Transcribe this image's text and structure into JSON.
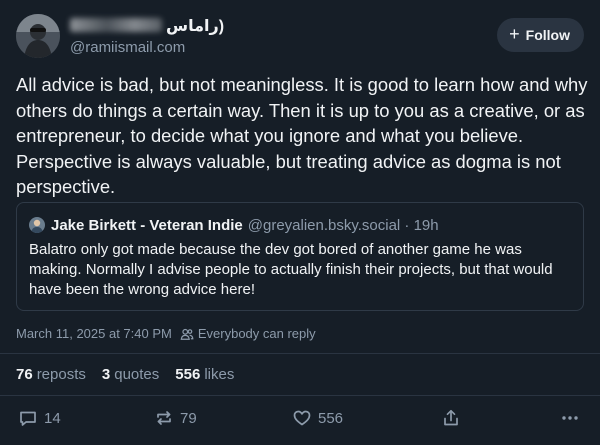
{
  "author": {
    "display_name_visible": "راماس)",
    "handle": "@ramiismail.com"
  },
  "follow_button": {
    "label": "Follow",
    "icon": "plus-icon"
  },
  "post": {
    "text": "All advice is bad, but not meaningless. It is good to learn how and why others do things a certain way. Then it is up to you as a creative, or as entrepreneur, to decide what you ignore and what you believe. Perspective is always valuable, but treating advice as dogma is not perspective."
  },
  "quote": {
    "name": "Jake Birkett - Veteran Indie",
    "handle": "@greyalien.bsky.social · 19h",
    "text": "Balatro only got made because the dev got bored of another game he was making. Normally I advise people to actually finish their projects, but that would have been the wrong advice here!"
  },
  "meta": {
    "timestamp": "March 11, 2025 at 7:40 PM",
    "reply_setting": "Everybody can reply",
    "reply_icon": "people-icon"
  },
  "stats": {
    "reposts_count": "76",
    "reposts_label": "reposts",
    "quotes_count": "3",
    "quotes_label": "quotes",
    "likes_count": "556",
    "likes_label": "likes"
  },
  "actions": {
    "reply_count": "14",
    "repost_count": "79",
    "like_count": "556",
    "share_icon": "share-icon",
    "more_icon": "more-icon"
  },
  "colors": {
    "background": "#161e27",
    "text": "#f1f3f5",
    "muted": "#8d9bab",
    "border": "#2f3a47",
    "button_bg": "#2a3441"
  }
}
